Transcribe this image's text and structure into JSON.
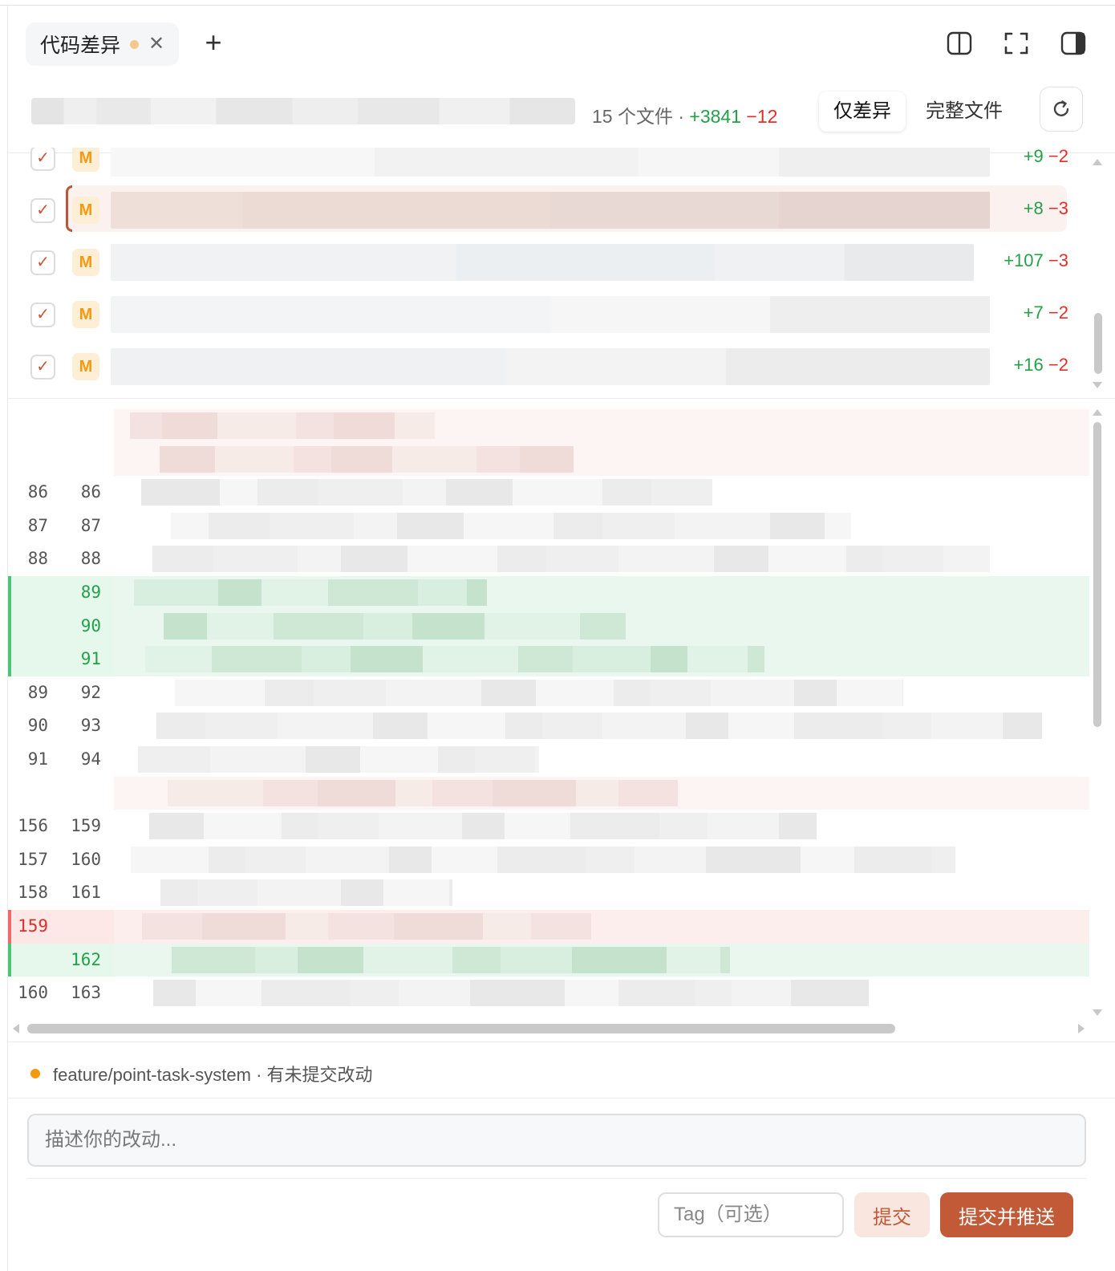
{
  "tab": {
    "label": "代码差异"
  },
  "toolbar": {
    "summary_prefix": "15 个文件 · ",
    "additions": "+3841",
    "deletions": "−12",
    "view_diff_only": "仅差异",
    "view_full_file": "完整文件"
  },
  "files": [
    {
      "status": "M",
      "add": "+9",
      "del": "−2"
    },
    {
      "status": "M",
      "add": "+8",
      "del": "−3"
    },
    {
      "status": "M",
      "add": "+107",
      "del": "−3"
    },
    {
      "status": "M",
      "add": "+7",
      "del": "−2"
    },
    {
      "status": "M",
      "add": "+16",
      "del": "−2"
    }
  ],
  "diff_lines": [
    {
      "kind": "hunk",
      "old": "",
      "new": ""
    },
    {
      "kind": "hunk",
      "old": "",
      "new": ""
    },
    {
      "kind": "ctx",
      "old": "86",
      "new": "86"
    },
    {
      "kind": "ctx",
      "old": "87",
      "new": "87"
    },
    {
      "kind": "ctx",
      "old": "88",
      "new": "88"
    },
    {
      "kind": "add",
      "old": "",
      "new": "89"
    },
    {
      "kind": "add",
      "old": "",
      "new": "90"
    },
    {
      "kind": "add",
      "old": "",
      "new": "91"
    },
    {
      "kind": "ctx",
      "old": "89",
      "new": "92"
    },
    {
      "kind": "ctx",
      "old": "90",
      "new": "93"
    },
    {
      "kind": "ctx",
      "old": "91",
      "new": "94"
    },
    {
      "kind": "hunk",
      "old": "",
      "new": ""
    },
    {
      "kind": "ctx",
      "old": "156",
      "new": "159"
    },
    {
      "kind": "ctx",
      "old": "157",
      "new": "160"
    },
    {
      "kind": "ctx",
      "old": "158",
      "new": "161"
    },
    {
      "kind": "del",
      "old": "159",
      "new": ""
    },
    {
      "kind": "add",
      "old": "",
      "new": "162"
    },
    {
      "kind": "ctx",
      "old": "160",
      "new": "163"
    }
  ],
  "branch": {
    "text": "feature/point-task-system · 有未提交改动"
  },
  "commit": {
    "message_placeholder": "描述你的改动...",
    "tag_placeholder": "Tag（可选）",
    "commit_label": "提交",
    "commit_push_label": "提交并推送"
  },
  "colors": {
    "accent": "#c25a38",
    "add": "#24a148",
    "del": "#e0302a",
    "modified_badge": "#f29a12"
  },
  "icons": [
    "close-icon",
    "plus-icon",
    "split-view-icon",
    "fullscreen-icon",
    "sidebar-icon",
    "refresh-icon",
    "check-icon"
  ]
}
